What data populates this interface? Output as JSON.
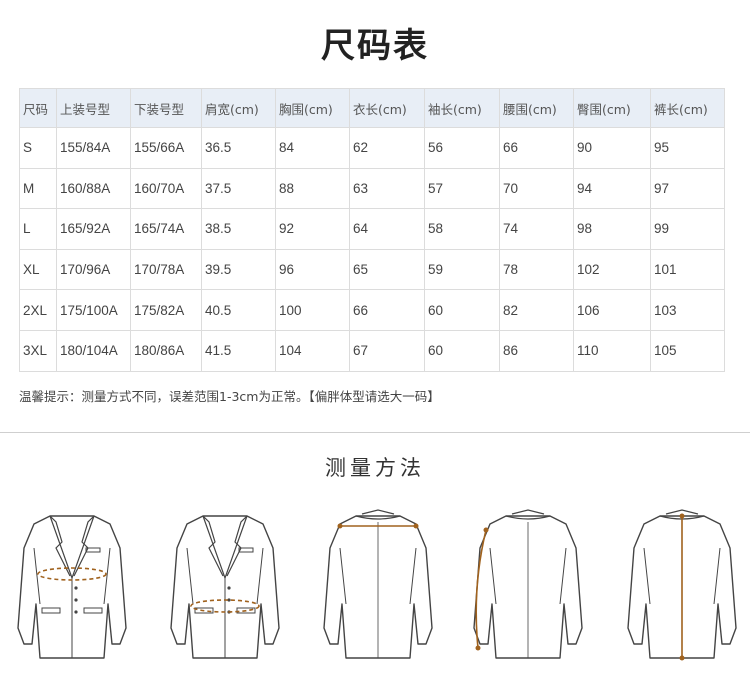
{
  "title": "尺码表",
  "table": {
    "headers": [
      "尺码",
      "上装号型",
      "下装号型",
      "肩宽(cm)",
      "胸围(cm)",
      "衣长(cm)",
      "袖长(cm)",
      "腰围(cm)",
      "臀围(cm)",
      "裤长(cm)"
    ],
    "rows": [
      [
        "S",
        "155/84A",
        "155/66A",
        "36.5",
        "84",
        "62",
        "56",
        "66",
        "90",
        "95"
      ],
      [
        "M",
        "160/88A",
        "160/70A",
        "37.5",
        "88",
        "63",
        "57",
        "70",
        "94",
        "97"
      ],
      [
        "L",
        "165/92A",
        "165/74A",
        "38.5",
        "92",
        "64",
        "58",
        "74",
        "98",
        "99"
      ],
      [
        "XL",
        "170/96A",
        "170/78A",
        "39.5",
        "96",
        "65",
        "59",
        "78",
        "102",
        "101"
      ],
      [
        "2XL",
        "175/100A",
        "175/82A",
        "40.5",
        "100",
        "66",
        "60",
        "82",
        "106",
        "103"
      ],
      [
        "3XL",
        "180/104A",
        "180/86A",
        "41.5",
        "104",
        "67",
        "60",
        "86",
        "110",
        "105"
      ]
    ]
  },
  "tip": "温馨提示：测量方式不同，误差范围1-3cm为正常。【偏胖体型请选大一码】",
  "method_title": "测量方法",
  "figures": [
    {
      "name": "chest-measure-figure",
      "view": "front",
      "measure": "chest"
    },
    {
      "name": "waist-measure-figure",
      "view": "front",
      "measure": "waist"
    },
    {
      "name": "shoulder-measure-figure",
      "view": "back",
      "measure": "shoulder"
    },
    {
      "name": "sleeve-measure-figure",
      "view": "back",
      "measure": "sleeve"
    },
    {
      "name": "length-measure-figure",
      "view": "back",
      "measure": "length"
    }
  ],
  "colors": {
    "header_bg": "#e8eef6",
    "measure": "#a0621e",
    "outline": "#444444"
  }
}
